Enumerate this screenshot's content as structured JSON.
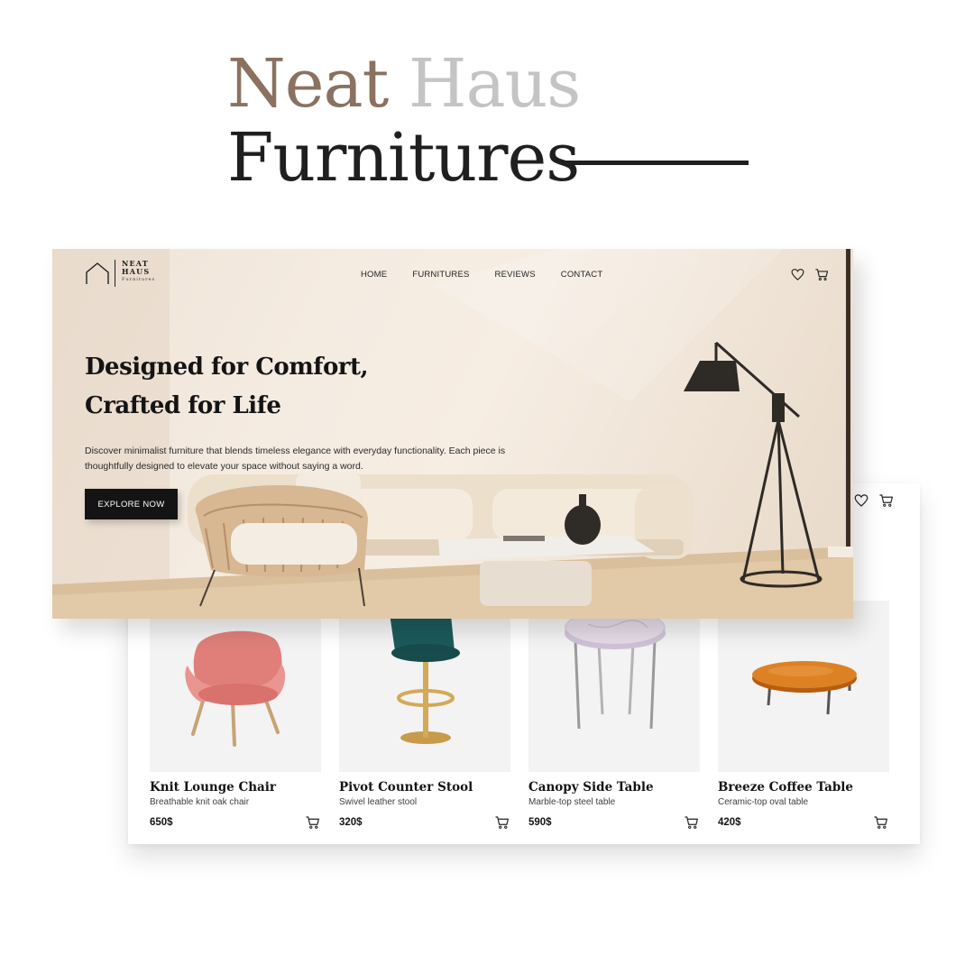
{
  "showcase": {
    "title_word_1": "Neat",
    "title_word_2": "Haus",
    "title_line_2": "Furnitures"
  },
  "brand": {
    "logo_line_1": "NEAT",
    "logo_line_2": "HAUS",
    "logo_sub": "Furnitures"
  },
  "nav": {
    "items": [
      {
        "label": "HOME"
      },
      {
        "label": "FURNITURES"
      },
      {
        "label": "REVIEWS"
      },
      {
        "label": "CONTACT"
      }
    ],
    "icons": [
      "heart-icon",
      "cart-icon"
    ]
  },
  "hero": {
    "heading_line_1": "Designed for Comfort,",
    "heading_line_2": "Crafted for Life",
    "description": "Discover minimalist furniture that blends timeless elegance with everyday functionality. Each piece is thoughtfully designed to elevate your space without saying a word.",
    "cta_label": "EXPLORE NOW"
  },
  "products": [
    {
      "name": "Knit Lounge Chair",
      "description": "Breathable knit oak chair",
      "price": "650$",
      "icon": "pink-armchair"
    },
    {
      "name": "Pivot Counter Stool",
      "description": "Swivel leather stool",
      "price": "320$",
      "icon": "teal-bar-stool"
    },
    {
      "name": "Canopy Side Table",
      "description": "Marble-top steel table",
      "price": "590$",
      "icon": "marble-side-table"
    },
    {
      "name": "Breeze Coffee Table",
      "description": "Ceramic-top oval table",
      "price": "420$",
      "icon": "orange-coffee-table"
    }
  ],
  "colors": {
    "accent_brown": "#8a7160",
    "muted_gray": "#c4c4c4",
    "ink": "#141414",
    "hero_bg": "#f4ebe1",
    "card_bg": "#f3f3f3"
  }
}
